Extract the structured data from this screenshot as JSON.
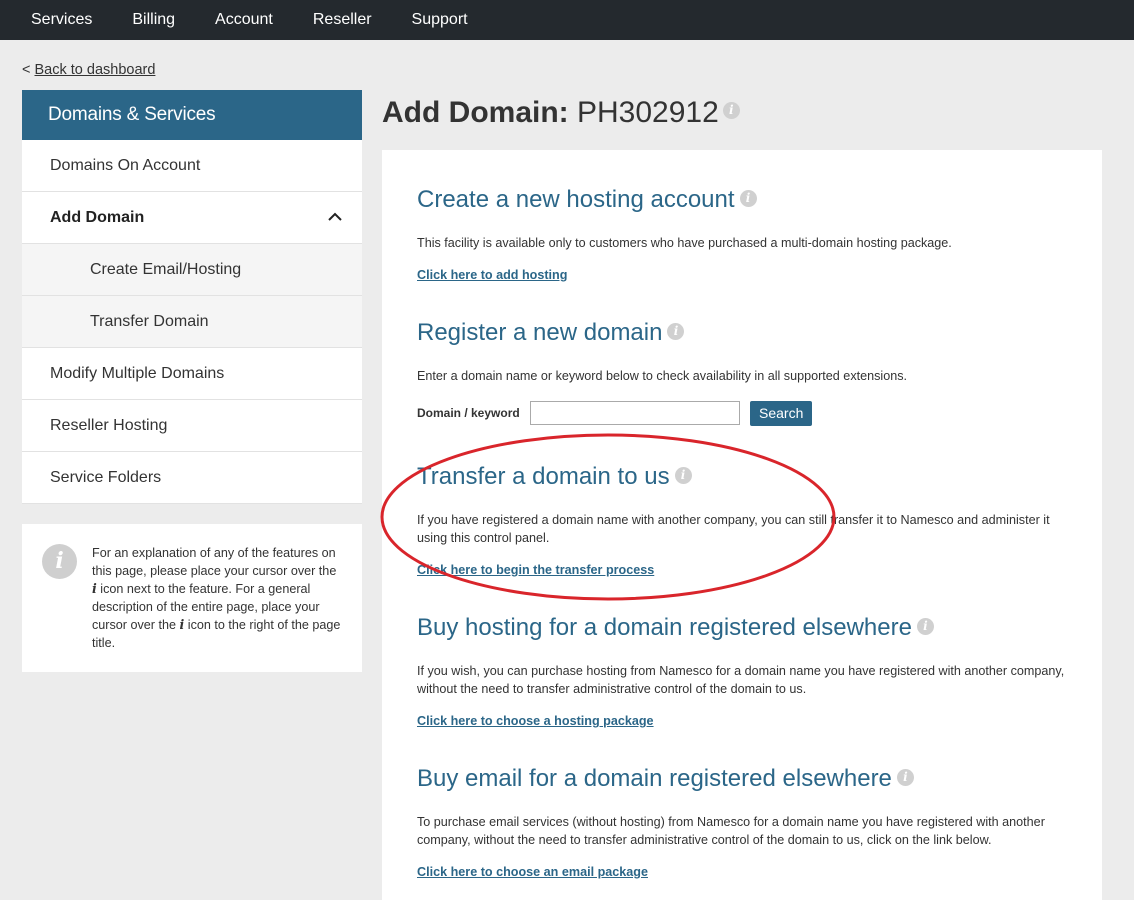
{
  "topnav": {
    "items": [
      "Services",
      "Billing",
      "Account",
      "Reseller",
      "Support"
    ]
  },
  "back": {
    "prefix": "<",
    "label": "Back to dashboard"
  },
  "sidebar": {
    "header": "Domains & Services",
    "items": [
      {
        "label": "Domains On Account"
      },
      {
        "label": "Add Domain"
      },
      {
        "label": "Create Email/Hosting"
      },
      {
        "label": "Transfer Domain"
      },
      {
        "label": "Modify Multiple Domains"
      },
      {
        "label": "Reseller Hosting"
      },
      {
        "label": "Service Folders"
      }
    ]
  },
  "infobox": {
    "icon": "info-icon",
    "text_1": "For an explanation of any of the features on this page, please place your cursor over the ",
    "glyph_1": "i",
    "text_2": " icon next to the feature. For a general description of the entire page, place your cursor over the ",
    "glyph_2": "i",
    "text_3": " icon to the right of the page title."
  },
  "page": {
    "title_bold": "Add Domain:",
    "title_id": "PH302912",
    "info_glyph": "i"
  },
  "sections": {
    "hosting": {
      "title": "Create a new hosting account",
      "text": "This facility is available only to customers who have purchased a multi-domain hosting package.",
      "link": "Click here to add hosting"
    },
    "register": {
      "title": "Register a new domain",
      "text": "Enter a domain name or keyword below to check availability in all supported extensions.",
      "field_label": "Domain / keyword",
      "field_value": "",
      "button": "Search"
    },
    "transfer": {
      "title": "Transfer a domain to us",
      "text": "If you have registered a domain name with another company, you can still transfer it to Namesco and administer it using this control panel.",
      "link": "Click here to begin the transfer process"
    },
    "buy_hosting": {
      "title": "Buy hosting for a domain registered elsewhere",
      "text": "If you wish, you can purchase hosting from Namesco for a domain name you have registered with another company, without the need to transfer administrative control of the domain to us.",
      "link": "Click here to choose a hosting package"
    },
    "buy_email": {
      "title": "Buy email for a domain registered elsewhere",
      "text": "To purchase email services (without hosting) from Namesco for a domain name you have registered with another company, without the need to transfer administrative control of the domain to us, click on the link below.",
      "link": "Click here to choose an email package"
    }
  },
  "colors": {
    "nav_bg": "#24292e",
    "accent": "#2b6688",
    "annotation": "#d9252b"
  }
}
